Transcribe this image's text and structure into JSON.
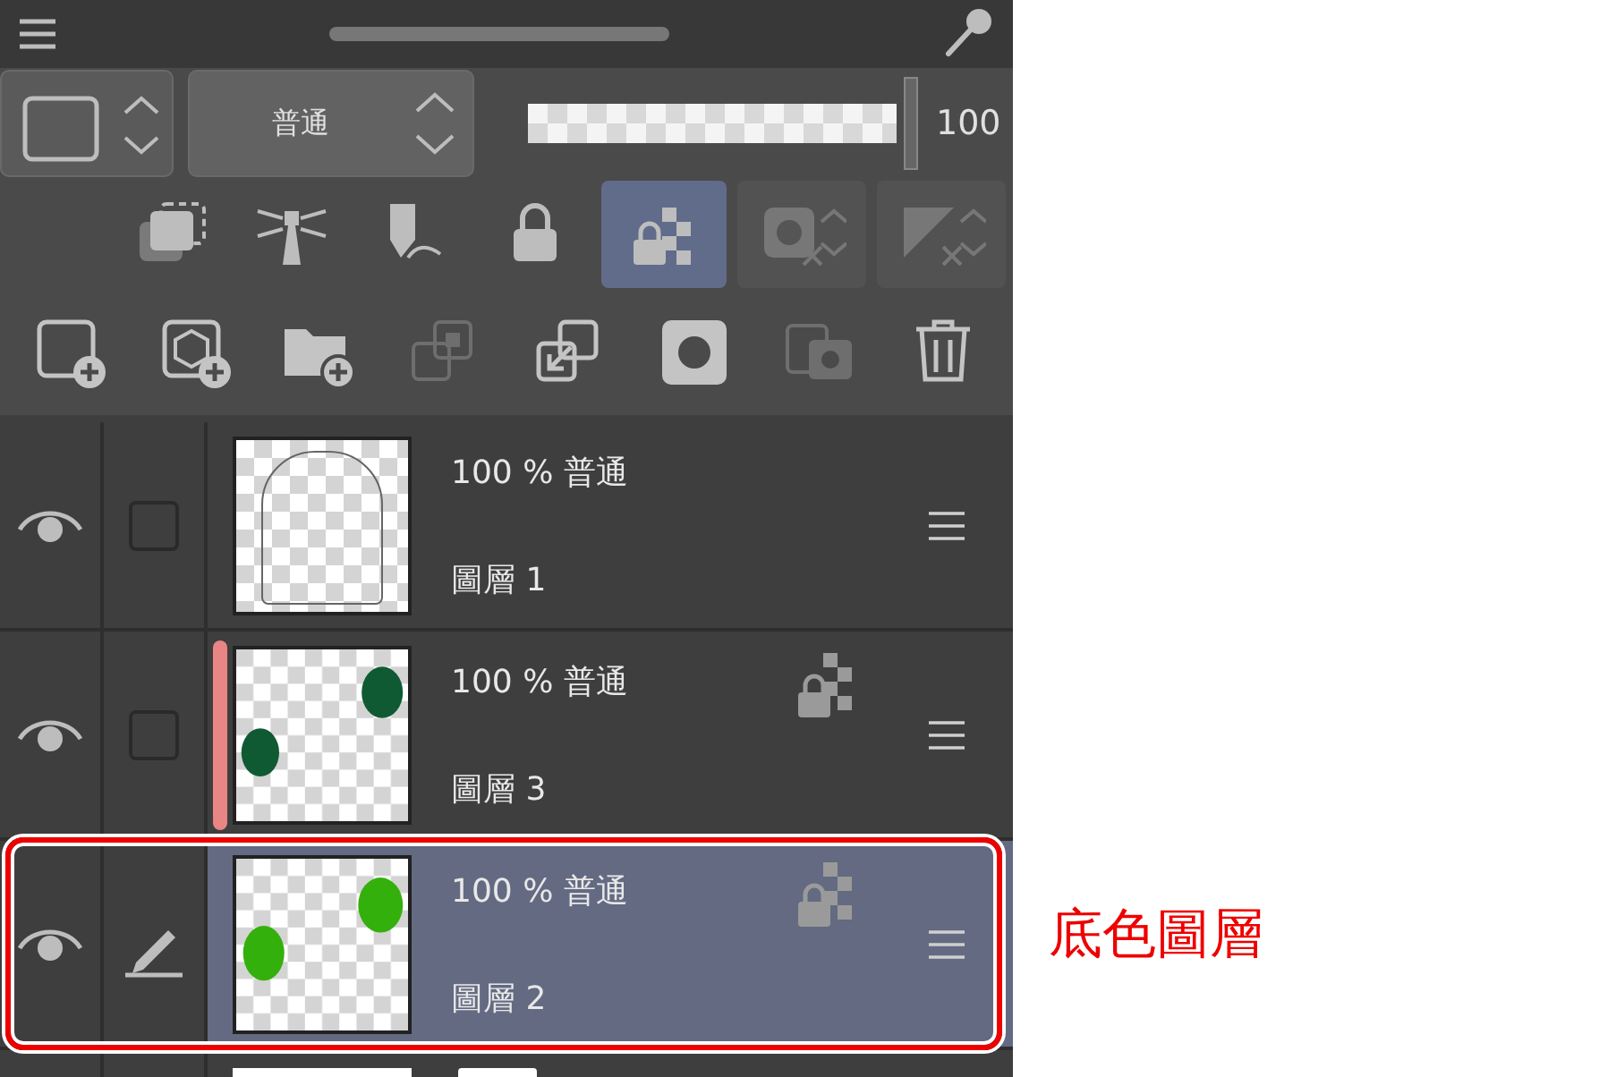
{
  "layer_properties": {
    "blend_mode": "普通",
    "opacity": {
      "level": 1,
      "reading": "100"
    }
  },
  "toggles": [
    {
      "kind": "clipping",
      "selected": false,
      "disabled": false
    },
    {
      "kind": "reference",
      "selected": false,
      "disabled": false
    },
    {
      "kind": "draft",
      "selected": false,
      "disabled": false
    },
    {
      "kind": "lock",
      "selected": false,
      "disabled": false
    },
    {
      "kind": "lock-transparency",
      "selected": true,
      "disabled": false
    },
    {
      "kind": "mask",
      "selected": false,
      "disabled": true
    },
    {
      "kind": "ruler",
      "selected": false,
      "disabled": true
    }
  ],
  "actions": [
    {
      "kind": "new-layer",
      "disabled": false
    },
    {
      "kind": "new-3d",
      "disabled": false
    },
    {
      "kind": "new-folder",
      "disabled": false
    },
    {
      "kind": "transfer-down",
      "disabled": true
    },
    {
      "kind": "merge-down",
      "disabled": false
    },
    {
      "kind": "add-mask",
      "disabled": false
    },
    {
      "kind": "apply-mask",
      "disabled": true
    },
    {
      "kind": "delete",
      "disabled": false
    }
  ],
  "layers": [
    {
      "opacity_blend": "100 % 普通",
      "name": "圖層 1",
      "visible": true,
      "editing": false,
      "thumbnail": {
        "kind": "sketch"
      },
      "lock_transparency": false,
      "selected": false,
      "highlighted": false
    },
    {
      "opacity_blend": "100 % 普通",
      "name": "圖層 3",
      "visible": true,
      "editing": false,
      "thumbnail": {
        "kind": "dark-green"
      },
      "lock_transparency": true,
      "selected": false,
      "highlighted": false,
      "color": "#e98585"
    },
    {
      "opacity_blend": "100 % 普通",
      "name": "圖層 2",
      "visible": true,
      "editing": true,
      "thumbnail": {
        "kind": "bright-green"
      },
      "lock_transparency": true,
      "selected": true,
      "highlighted": true
    }
  ],
  "annotation": {
    "label": "底色圖層"
  }
}
